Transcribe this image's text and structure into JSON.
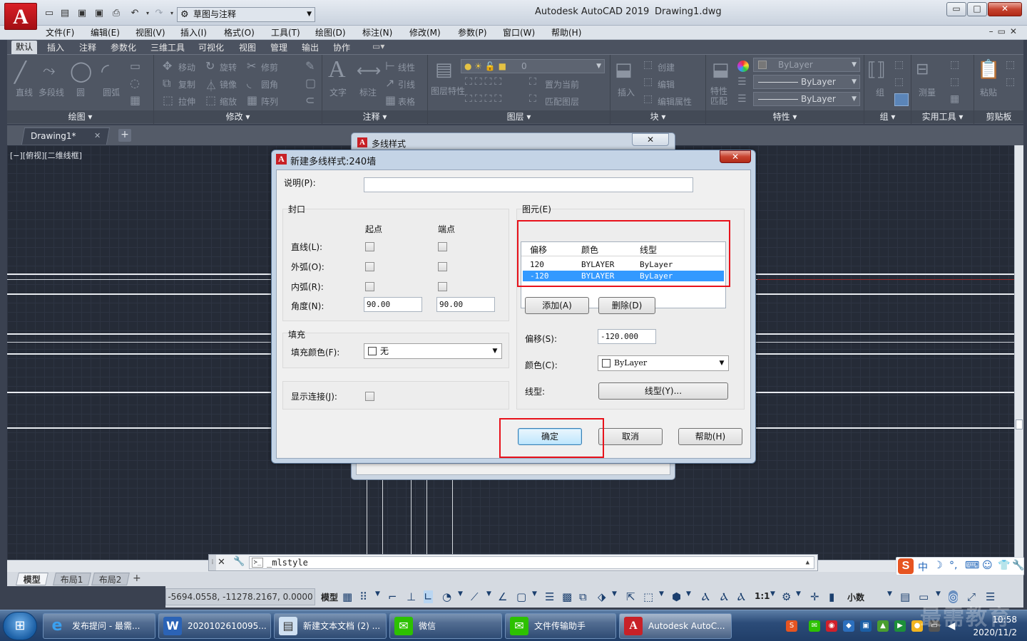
{
  "titlebar": {
    "app_title": "Autodesk AutoCAD 2019",
    "document": "Drawing1.dwg",
    "workspace": "草图与注释",
    "logo": "A",
    "min": "▭",
    "max": "□",
    "close": "✕"
  },
  "menu": [
    "文件(F)",
    "编辑(E)",
    "视图(V)",
    "插入(I)",
    "格式(O)",
    "工具(T)",
    "绘图(D)",
    "标注(N)",
    "修改(M)",
    "参数(P)",
    "窗口(W)",
    "帮助(H)"
  ],
  "ribbon_tabs": [
    "默认",
    "插入",
    "注释",
    "参数化",
    "三维工具",
    "可视化",
    "视图",
    "管理",
    "输出",
    "协作"
  ],
  "ribbon": {
    "draw": {
      "title": "绘图",
      "tools": [
        "直线",
        "多段线",
        "圆",
        "圆弧"
      ]
    },
    "modify": {
      "title": "修改",
      "tools": [
        "移动",
        "旋转",
        "修剪",
        "复制",
        "镜像",
        "圆角",
        "拉伸",
        "缩放",
        "阵列"
      ]
    },
    "annotation": {
      "title": "注释",
      "tools": [
        "文字",
        "标注",
        "线性",
        "引线",
        "表格"
      ]
    },
    "layers": {
      "title": "图层",
      "current_layer": "0",
      "tools": [
        "图层特性",
        "置为当前",
        "匹配图层"
      ]
    },
    "block": {
      "title": "块",
      "tools": [
        "插入",
        "创建",
        "编辑",
        "编辑属性"
      ]
    },
    "properties": {
      "title": "特性",
      "color": "ByLayer",
      "linetype": "ByLayer",
      "lineweight": "ByLayer",
      "tools": [
        "特性匹配"
      ]
    },
    "groups": {
      "title": "组",
      "tools": [
        "组"
      ]
    },
    "utilities": {
      "title": "实用工具",
      "tools": [
        "测量"
      ]
    },
    "clipboard": {
      "title": "剪贴板",
      "tools": [
        "粘贴"
      ]
    }
  },
  "doc_tab": {
    "label": "Drawing1*",
    "close": "✕",
    "new": "+"
  },
  "viewport_label": "[−][俯视][二维线框]",
  "bg_dialog": {
    "title": "多线样式",
    "close": "✕"
  },
  "dialog": {
    "title": "新建多线样式:240墙",
    "close": "✕",
    "description_label": "说明(P):",
    "description_value": "",
    "caps_title": "封口",
    "start_header": "起点",
    "end_header": "端点",
    "line_label": "直线(L):",
    "outer_arc_label": "外弧(O):",
    "inner_arc_label": "内弧(R):",
    "angle_label": "角度(N):",
    "angle_start": "90.00",
    "angle_end": "90.00",
    "fill_title": "填充",
    "fill_color_label": "填充颜色(F):",
    "fill_color_value": "无",
    "display_joints_label": "显示连接(J):",
    "elements_title": "图元(E)",
    "elements_headers": {
      "offset": "偏移",
      "color": "颜色",
      "linetype": "线型"
    },
    "elements": [
      {
        "offset": "120",
        "color": "BYLAYER",
        "linetype": "ByLayer",
        "selected": false
      },
      {
        "offset": "-120",
        "color": "BYLAYER",
        "linetype": "ByLayer",
        "selected": true
      }
    ],
    "add_button": "添加(A)",
    "delete_button": "删除(D)",
    "offset_label": "偏移(S):",
    "offset_value": "-120.000",
    "color_label": "颜色(C):",
    "color_value": "ByLayer",
    "linetype_label": "线型:",
    "linetype_button": "线型(Y)...",
    "ok_button": "确定",
    "cancel_button": "取消",
    "help_button": "帮助(H)"
  },
  "command_line": {
    "text": "_mlstyle",
    "prompt_icon": "≻_"
  },
  "layout_tabs": [
    "模型",
    "布局1",
    "布局2"
  ],
  "layout_add": "+",
  "status": {
    "coordinates": "-5694.0558, -11278.2167, 0.0000",
    "model": "模型",
    "scale": "1:1",
    "units": "小数"
  },
  "ime": {
    "logo": "S",
    "lang": "中"
  },
  "taskbar": {
    "items": [
      {
        "label": "发布提问 - 最需...",
        "icon": "ie-icon"
      },
      {
        "label": "2020102610095...",
        "icon": "word-icon"
      },
      {
        "label": "新建文本文档 (2) ...",
        "icon": "notepad-icon"
      },
      {
        "label": "微信",
        "icon": "wechat-icon"
      },
      {
        "label": "文件传输助手",
        "icon": "wechat-icon"
      },
      {
        "label": "Autodesk AutoC...",
        "icon": "autocad-icon"
      }
    ],
    "clock_time": "10:58",
    "clock_date": "2020/11/2"
  },
  "watermark": "最需教育",
  "colors": {
    "highlight_red": "#e8121b",
    "selection_blue": "#3399ff",
    "canvas": "#252b37"
  }
}
